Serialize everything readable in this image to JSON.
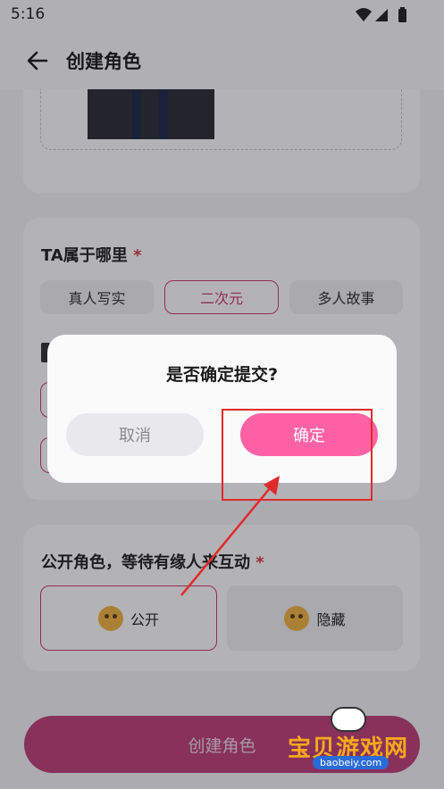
{
  "status": {
    "time": "5:16"
  },
  "header": {
    "title": "创建角色"
  },
  "belong": {
    "title": "TA属于哪里",
    "required": "*",
    "options": [
      "真人写实",
      "二次元",
      "多人故事"
    ],
    "selected": "二次元"
  },
  "visibility": {
    "title": "公开角色，等待有缘人来互动",
    "required": "*",
    "public_label": "公开",
    "hidden_label": "隐藏",
    "selected": "公开"
  },
  "create_button": {
    "label": "创建角色"
  },
  "dialog": {
    "title": "是否确定提交?",
    "cancel_label": "取消",
    "confirm_label": "确定"
  },
  "watermark": {
    "text": "宝贝游戏网",
    "url": "baobeiy.com"
  },
  "colors": {
    "accent": "#ff62a4",
    "selected_border": "#cf3a6e",
    "annotation": "#e02a2a"
  },
  "icons": [
    "back-arrow-icon",
    "wifi-icon",
    "signal-icon",
    "battery-icon",
    "thinking-face-icon",
    "neutral-face-icon"
  ]
}
